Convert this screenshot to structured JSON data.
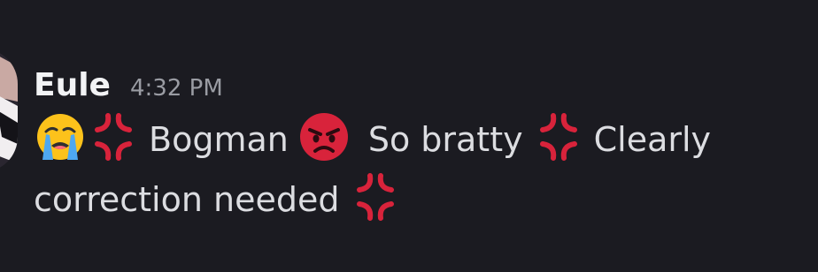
{
  "message": {
    "author": "Eule",
    "timestamp": "4:32 PM",
    "parts": {
      "word_bogman": "Bogman",
      "phrase_so_bratty": "So bratty",
      "word_clearly": "Clearly",
      "phrase_correction": "correction needed"
    },
    "emojis": [
      "loudly-crying-face-emoji",
      "anger-symbol-emoji",
      "pouting-face-emoji",
      "anger-symbol-emoji",
      "anger-symbol-emoji"
    ]
  },
  "colors": {
    "background": "#1b1b21",
    "username": "#f2f3f5",
    "timestamp": "#9a9ca3",
    "text": "#dcdde1",
    "anger_red": "#d8233b"
  }
}
